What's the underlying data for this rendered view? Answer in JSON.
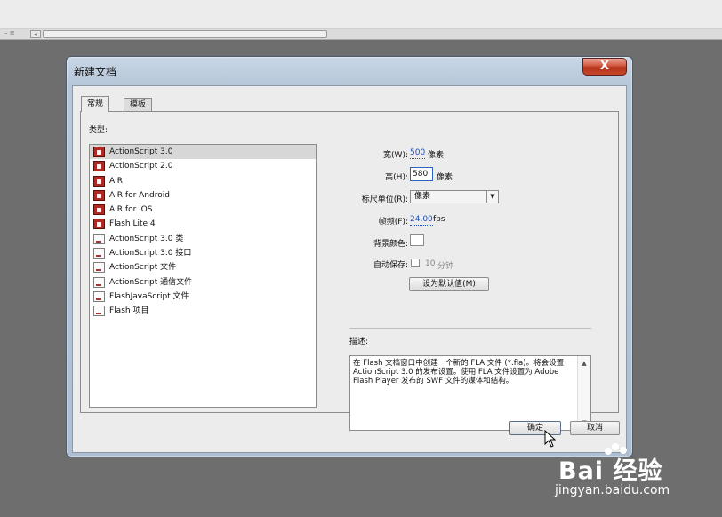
{
  "dialog": {
    "title": "新建文档",
    "close_label": "X",
    "tabs": [
      {
        "label": "常规",
        "active": true
      },
      {
        "label": "模板",
        "active": false
      }
    ],
    "type_label": "类型:",
    "types": [
      {
        "label": "ActionScript 3.0",
        "icon": "red-doc-icon",
        "selected": true
      },
      {
        "label": "ActionScript 2.0",
        "icon": "red-doc-icon",
        "selected": false
      },
      {
        "label": "AIR",
        "icon": "red-doc-icon",
        "selected": false
      },
      {
        "label": "AIR for Android",
        "icon": "red-doc-icon",
        "selected": false
      },
      {
        "label": "AIR for iOS",
        "icon": "red-doc-icon",
        "selected": false
      },
      {
        "label": "Flash Lite 4",
        "icon": "red-doc-icon",
        "selected": false
      },
      {
        "label": "ActionScript 3.0 类",
        "icon": "script-doc-icon",
        "selected": false
      },
      {
        "label": "ActionScript 3.0 接口",
        "icon": "script-doc-icon",
        "selected": false
      },
      {
        "label": "ActionScript 文件",
        "icon": "script-doc-icon",
        "selected": false
      },
      {
        "label": "ActionScript 通信文件",
        "icon": "script-doc-icon",
        "selected": false
      },
      {
        "label": "FlashJavaScript 文件",
        "icon": "script-doc-icon",
        "selected": false
      },
      {
        "label": "Flash 项目",
        "icon": "project-doc-icon",
        "selected": false
      }
    ],
    "settings": {
      "width_label": "宽(W):",
      "width_value": "500",
      "width_unit": "像素",
      "height_label": "高(H):",
      "height_value": "580",
      "height_unit": "像素",
      "ruler_label": "标尺单位(R):",
      "ruler_value": "像素",
      "fps_label": "帧频(F):",
      "fps_value": "24.00",
      "fps_unit": "fps",
      "bgcolor_label": "背景颜色:",
      "bgcolor": "#ffffff",
      "autosave_label": "自动保存:",
      "autosave_value": "10",
      "autosave_unit": "分钟",
      "default_button": "设为默认值(M)"
    },
    "description_label": "描述:",
    "description": "在 Flash 文档窗口中创建一个新的 FLA 文件 (*.fla)。将会设置 ActionScript 3.0 的发布设置。使用 FLA 文件设置为 Adobe Flash Player 发布的 SWF 文件的媒体和结构。",
    "ok_button": "确定",
    "cancel_button": "取消"
  },
  "watermark": {
    "brand": "Bai 经验",
    "url": "jingyan.baidu.com"
  },
  "colors": {
    "close_red": "#c8462b",
    "link_blue": "#1f4fb4",
    "selected_row": "#d7d7d7"
  }
}
